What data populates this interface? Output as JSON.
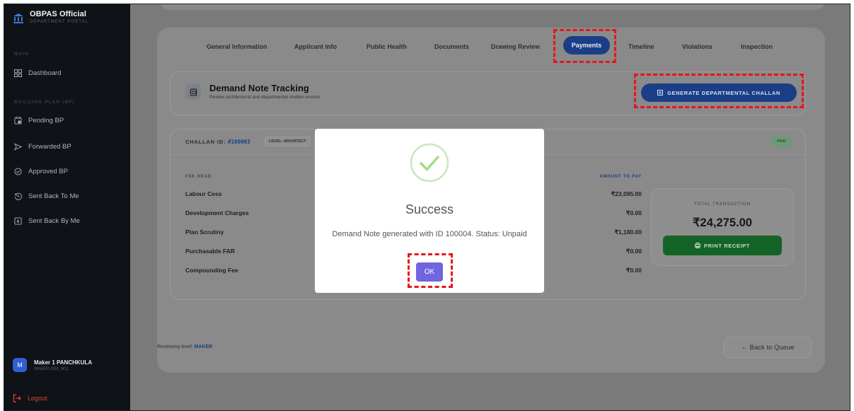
{
  "sidebar": {
    "brand_title": "OBPAS Official",
    "brand_subtitle": "DEPARTMENT PORTAL",
    "section_main": "MAIN",
    "dashboard": "Dashboard",
    "section_bp": "BUILDING PLAN (BP)",
    "items": [
      {
        "label": "Pending BP",
        "icon": "pending-icon"
      },
      {
        "label": "Forwarded BP",
        "icon": "forward-icon"
      },
      {
        "label": "Approved BP",
        "icon": "check-circle-icon"
      },
      {
        "label": "Sent Back To Me",
        "icon": "history-icon"
      },
      {
        "label": "Sent Back By Me",
        "icon": "return-box-icon"
      }
    ],
    "user": {
      "initial": "M",
      "name": "Maker 1 PANCHKULA",
      "role": "MAKER (053_M1)"
    },
    "logout": "Logout"
  },
  "tabs": [
    {
      "label": "General Information"
    },
    {
      "label": "Applicant Info"
    },
    {
      "label": "Public Health"
    },
    {
      "label": "Documents"
    },
    {
      "label": "Drawing Review"
    },
    {
      "label": "Payments",
      "active": true
    },
    {
      "label": "Timeline"
    },
    {
      "label": "Violations"
    },
    {
      "label": "Inspection"
    }
  ],
  "demand_note": {
    "title": "Demand Note Tracking",
    "subtitle": "Review architectural and departmental challan records",
    "generate_button": "GENERATE DEPARTMENTAL CHALLAN"
  },
  "challan": {
    "id_label": "CHALLAN ID:",
    "id_value": "#100003",
    "level": "LEVEL: ARCHITECT",
    "status": "PAID",
    "fee_head_label": "FEE HEAD",
    "amount_label": "AMOUNT TO PAY",
    "rows": [
      {
        "name": "Labour Cess",
        "amount": "₹23,095.00"
      },
      {
        "name": "Development Charges",
        "amount": "₹0.00"
      },
      {
        "name": "Plan Scrutiny",
        "amount": "₹1,180.00"
      },
      {
        "name": "Purchasable FAR",
        "amount": "₹0.00"
      },
      {
        "name": "Compounding Fee",
        "amount": "₹0.00"
      }
    ],
    "total_label": "TOTAL TRANSACTION",
    "total_value": "₹24,275.00",
    "print_button": "PRINT RECEIPT"
  },
  "footer": {
    "reviewing_prefix": "Reviewing level:",
    "reviewing_level": "MAKER",
    "back_button": "← Back to Queue"
  },
  "modal": {
    "title": "Success",
    "message": "Demand Note generated with ID 100004. Status: Unpaid",
    "ok": "OK"
  },
  "colors": {
    "accent": "#1a3f87",
    "success_green": "#146326",
    "ok_button": "#7066e0",
    "highlight": "#e8141c"
  }
}
